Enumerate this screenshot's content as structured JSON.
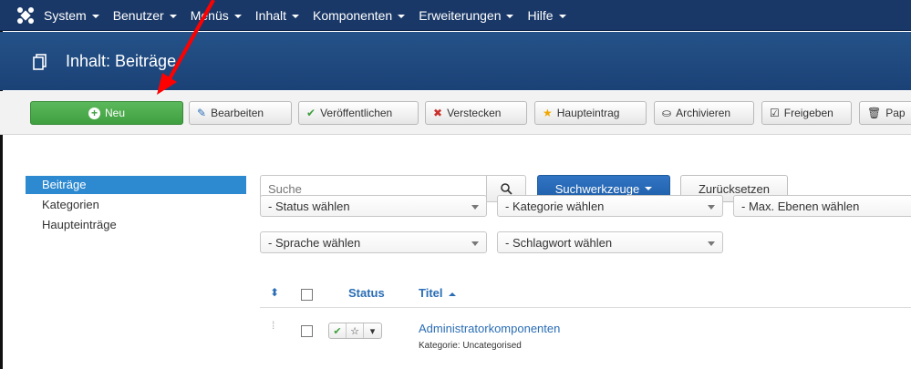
{
  "navbar": {
    "logo_icon": "joomla-icon",
    "items": [
      {
        "label": "System"
      },
      {
        "label": "Benutzer"
      },
      {
        "label": "Menüs"
      },
      {
        "label": "Inhalt"
      },
      {
        "label": "Komponenten"
      },
      {
        "label": "Erweiterungen"
      },
      {
        "label": "Hilfe"
      }
    ]
  },
  "title": {
    "icon": "stack-icon",
    "text": "Inhalt: Beiträge"
  },
  "toolbar": {
    "new": "Neu",
    "edit": "Bearbeiten",
    "publish": "Veröffentlichen",
    "unpublish": "Verstecken",
    "featured": "Haupteintrag",
    "archive": "Archivieren",
    "checkin": "Freigeben",
    "trash": "Pap"
  },
  "sidebar": {
    "items": [
      {
        "label": "Beiträge",
        "active": true
      },
      {
        "label": "Kategorien"
      },
      {
        "label": "Haupteinträge"
      }
    ]
  },
  "search": {
    "placeholder": "Suche",
    "tools_label": "Suchwerkzeuge",
    "reset_label": "Zurücksetzen"
  },
  "filters": {
    "status": "- Status wählen",
    "category": "- Kategorie wählen",
    "max_levels": "- Max. Ebenen wählen",
    "language": "- Sprache wählen",
    "tag": "- Schlagwort wählen"
  },
  "table": {
    "headers": {
      "status": "Status",
      "title": "Titel"
    },
    "rows": [
      {
        "title": "Administratorkomponenten",
        "category": "Kategorie: Uncategorised"
      }
    ]
  },
  "colors": {
    "navbar": "#1a3867",
    "titlebar": "#1f4a80",
    "new_button": "#4cae4c",
    "primary_button": "#2a6db5",
    "link": "#2a6db5",
    "annotation_arrow": "#ff0000"
  }
}
